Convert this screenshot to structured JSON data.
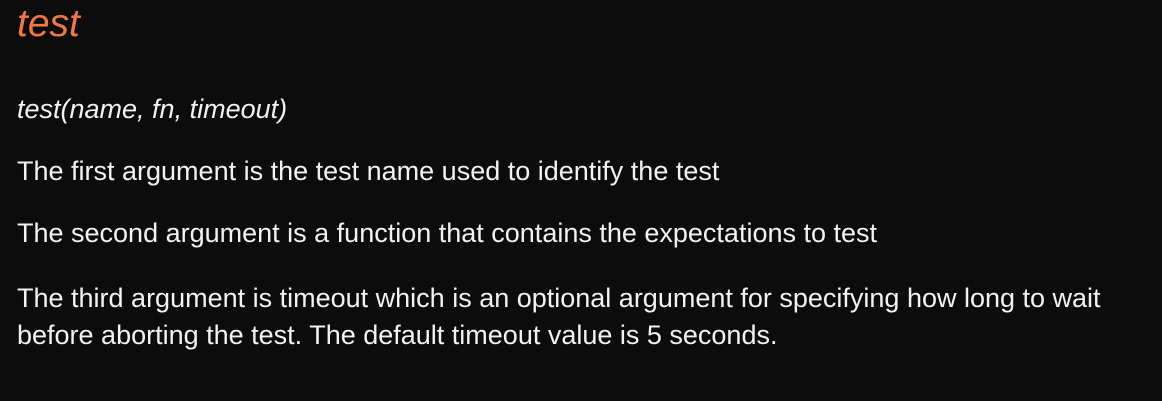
{
  "slide": {
    "title": "test",
    "signature": "test(name, fn, timeout)",
    "paragraphs": [
      "The first argument is the test name used to identify the test",
      "The second argument is a function that contains the expectations to test",
      "The third argument is timeout which is an optional argument for specifying how long to wait before aborting the test. The default timeout value is 5 seconds."
    ]
  },
  "colors": {
    "background": "#0c0c0c",
    "title": "#f07846",
    "text": "#f2f2f2"
  }
}
